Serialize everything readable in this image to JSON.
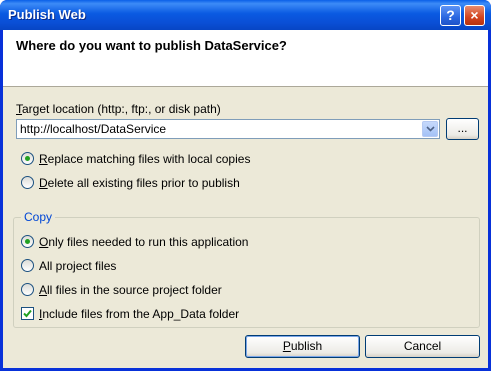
{
  "window": {
    "title": "Publish Web",
    "help_glyph": "?",
    "close_glyph": "×"
  },
  "header": {
    "question": "Where do you want to publish DataService?"
  },
  "target": {
    "label_mnemonic": "T",
    "label_rest": "arget location (http:, ftp:, or disk path)",
    "value": "http://localhost/DataService",
    "browse_label": "..."
  },
  "replace_options": [
    {
      "pre": "",
      "mnemonic": "R",
      "post": "eplace matching files with local copies",
      "selected": true
    },
    {
      "pre": "",
      "mnemonic": "D",
      "post": "elete all existing files prior to publish",
      "selected": false
    }
  ],
  "copy_group": {
    "label": "Copy",
    "options": [
      {
        "pre": "",
        "mnemonic": "O",
        "post": "nly files needed to run this application",
        "selected": true
      },
      {
        "pre": "All pro",
        "mnemonic": "j",
        "post": "ect files",
        "selected": false
      },
      {
        "pre": "",
        "mnemonic": "A",
        "post": "ll files in the source project folder",
        "selected": false
      }
    ],
    "include_app_data": {
      "pre": "",
      "mnemonic": "I",
      "post": "nclude files from the App_Data folder",
      "checked": true
    }
  },
  "buttons": {
    "publish_mnemonic": "P",
    "publish_rest": "ublish",
    "cancel": "Cancel"
  },
  "colors": {
    "titlebar": "#0a5ae2",
    "group_label": "#0046d5",
    "radio_dot": "#21a121"
  }
}
